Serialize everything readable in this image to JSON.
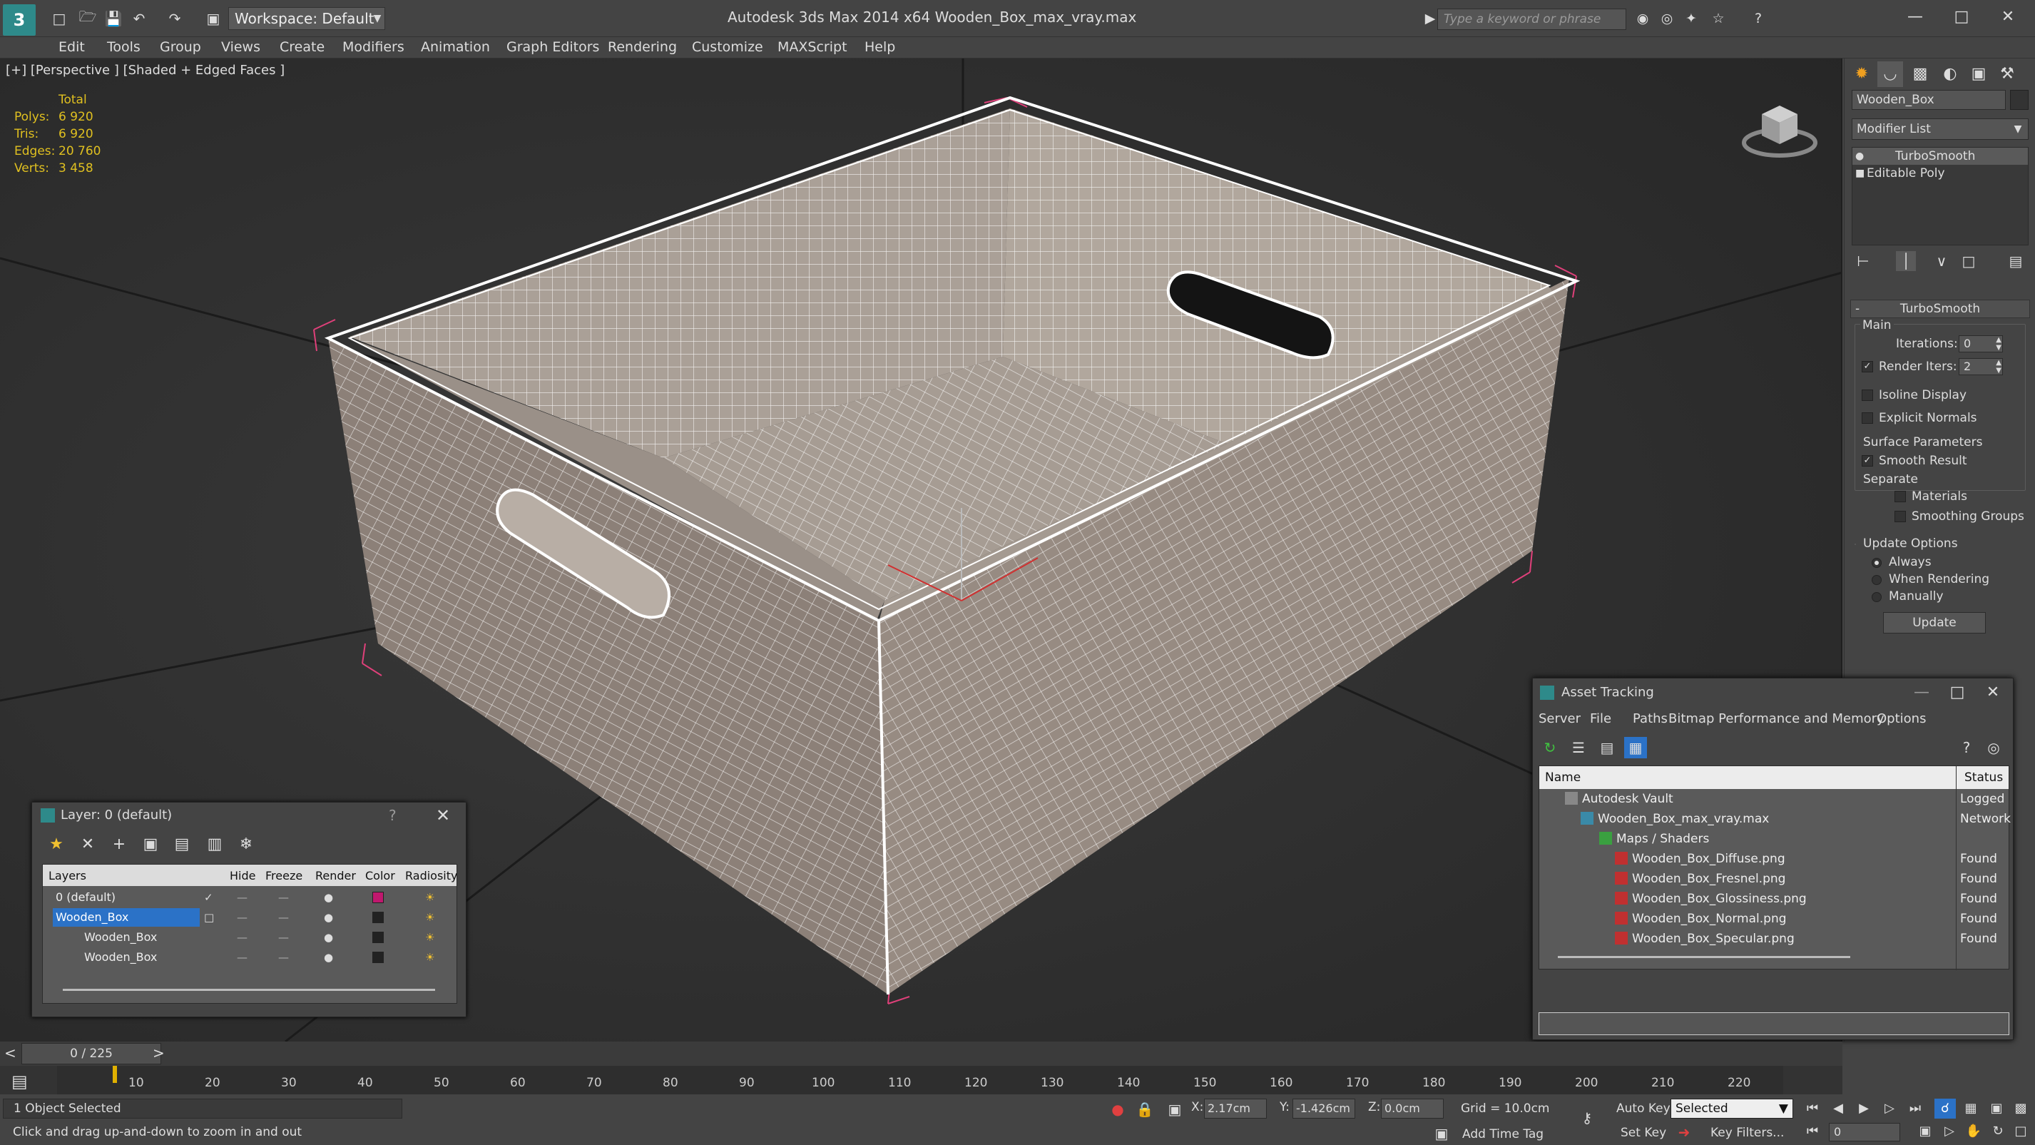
{
  "app": {
    "title": "Autodesk 3ds Max  2014 x64     Wooden_Box_max_vray.max",
    "logo": "3",
    "workspace": "Workspace: Default",
    "search_placeholder": "Type a keyword or phrase"
  },
  "menus": [
    "Edit",
    "Tools",
    "Group",
    "Views",
    "Create",
    "Modifiers",
    "Animation",
    "Graph Editors",
    "Rendering",
    "Customize",
    "MAXScript",
    "Help"
  ],
  "viewport": {
    "label": "[+] [Perspective ] [Shaded + Edged Faces ]",
    "stats_header": "Total",
    "stats": [
      {
        "label": "Polys:",
        "value": "6 920"
      },
      {
        "label": "Tris:",
        "value": "6 920"
      },
      {
        "label": "Edges:",
        "value": "20 760"
      },
      {
        "label": "Verts:",
        "value": "3 458"
      }
    ]
  },
  "command_panel": {
    "object_name": "Wooden_Box",
    "modifier_list": "Modifier List",
    "stack": [
      "TurboSmooth",
      "Editable Poly"
    ],
    "rollout_title": "TurboSmooth",
    "main_label": "Main",
    "iterations_label": "Iterations:",
    "iterations_value": "0",
    "render_iters_label": "Render Iters:",
    "render_iters_value": "2",
    "isoline_label": "Isoline Display",
    "explicit_label": "Explicit Normals",
    "surface_label": "Surface Parameters",
    "smooth_label": "Smooth Result",
    "separate_label": "Separate",
    "materials_label": "Materials",
    "smoothing_label": "Smoothing Groups",
    "update_options_label": "Update Options",
    "always_label": "Always",
    "when_rendering_label": "When Rendering",
    "manually_label": "Manually",
    "update_button": "Update"
  },
  "layer_dialog": {
    "title": "Layer: 0 (default)",
    "help": "?",
    "columns": [
      "Layers",
      "Hide",
      "Freeze",
      "Render",
      "Color",
      "Radiosity"
    ],
    "rows": [
      {
        "name": "0 (default)",
        "color": "#c0186e",
        "selected": false
      },
      {
        "name": "Wooden_Box",
        "color": "#222222",
        "selected": true
      },
      {
        "name": "Wooden_Box",
        "color": "#222222",
        "selected": false
      },
      {
        "name": "Wooden_Box",
        "color": "#222222",
        "selected": false
      }
    ]
  },
  "asset_tracking": {
    "title": "Asset Tracking",
    "menus": [
      "Server",
      "File",
      "Paths",
      "Bitmap Performance and Memory",
      "Options"
    ],
    "columns": [
      "Name",
      "Status"
    ],
    "rows": [
      {
        "name": "Autodesk Vault",
        "status": "Logged",
        "indent": 0
      },
      {
        "name": "Wooden_Box_max_vray.max",
        "status": "Network",
        "indent": 1
      },
      {
        "name": "Maps / Shaders",
        "status": "",
        "indent": 2
      },
      {
        "name": "Wooden_Box_Diffuse.png",
        "status": "Found",
        "indent": 3
      },
      {
        "name": "Wooden_Box_Fresnel.png",
        "status": "Found",
        "indent": 3
      },
      {
        "name": "Wooden_Box_Glossiness.png",
        "status": "Found",
        "indent": 3
      },
      {
        "name": "Wooden_Box_Normal.png",
        "status": "Found",
        "indent": 3
      },
      {
        "name": "Wooden_Box_Specular.png",
        "status": "Found",
        "indent": 3
      }
    ]
  },
  "timeline": {
    "frame_label": "0 / 225",
    "ticks": [
      "10",
      "20",
      "30",
      "40",
      "50",
      "60",
      "70",
      "80",
      "90",
      "100",
      "110",
      "120",
      "130",
      "140",
      "150",
      "160",
      "170",
      "180",
      "190",
      "200",
      "210",
      "220"
    ]
  },
  "status": {
    "selection": "1 Object Selected",
    "prompt": "Click and drag up-and-down to zoom in and out",
    "x_label": "X:",
    "x_value": "2.17cm",
    "y_label": "Y:",
    "y_value": "-1.426cm",
    "z_label": "Z:",
    "z_value": "0.0cm",
    "grid": "Grid = 10.0cm",
    "add_time_tag": "Add Time Tag",
    "auto_key": "Auto Key",
    "set_key": "Set Key",
    "selected": "Selected",
    "key_filters": "Key Filters...",
    "frame": "0"
  }
}
